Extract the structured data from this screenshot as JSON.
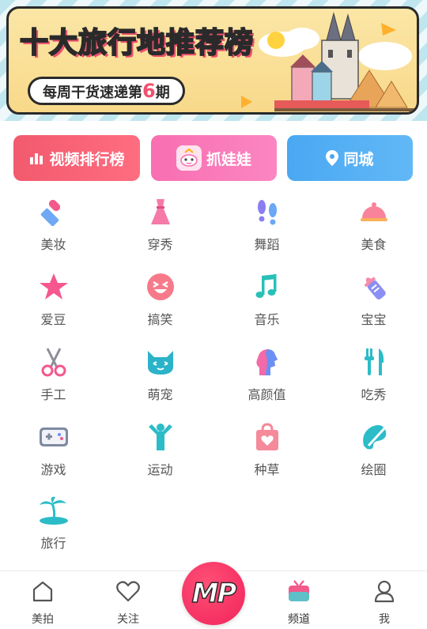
{
  "banner": {
    "title": "十大旅行地推荐榜",
    "subtitle_prefix": "每周干货速递第",
    "issue_number": "6",
    "subtitle_suffix": "期"
  },
  "quick_buttons": [
    {
      "label": "视频排行榜",
      "icon": "bar-chart-icon",
      "color": "#f25a6e"
    },
    {
      "label": "抓娃娃",
      "icon": "claw-machine-icon",
      "color": "#f86fb0"
    },
    {
      "label": "同城",
      "icon": "location-pin-icon",
      "color": "#4aa8f2"
    }
  ],
  "categories": [
    {
      "label": "美妆",
      "icon": "lipstick-icon"
    },
    {
      "label": "穿秀",
      "icon": "dress-icon"
    },
    {
      "label": "舞蹈",
      "icon": "footprints-icon"
    },
    {
      "label": "美食",
      "icon": "food-cloche-icon"
    },
    {
      "label": "爱豆",
      "icon": "star-icon"
    },
    {
      "label": "搞笑",
      "icon": "laughing-face-icon"
    },
    {
      "label": "音乐",
      "icon": "music-note-icon"
    },
    {
      "label": "宝宝",
      "icon": "baby-bottle-icon"
    },
    {
      "label": "手工",
      "icon": "scissors-icon"
    },
    {
      "label": "萌宠",
      "icon": "cat-icon"
    },
    {
      "label": "高颜值",
      "icon": "face-profile-icon"
    },
    {
      "label": "吃秀",
      "icon": "fork-knife-icon"
    },
    {
      "label": "游戏",
      "icon": "gamepad-icon"
    },
    {
      "label": "运动",
      "icon": "person-cheer-icon"
    },
    {
      "label": "种草",
      "icon": "shopping-bag-heart-icon"
    },
    {
      "label": "绘圈",
      "icon": "paint-brush-icon"
    },
    {
      "label": "旅行",
      "icon": "palm-island-icon"
    }
  ],
  "tabbar": {
    "home": "美拍",
    "follow": "关注",
    "center": "MP",
    "channel": "频道",
    "me": "我"
  },
  "colors": {
    "accent_red": "#f25a6e",
    "accent_pink": "#f86fb0",
    "accent_blue": "#4aa8f2",
    "mp_button": "#f1235a"
  }
}
